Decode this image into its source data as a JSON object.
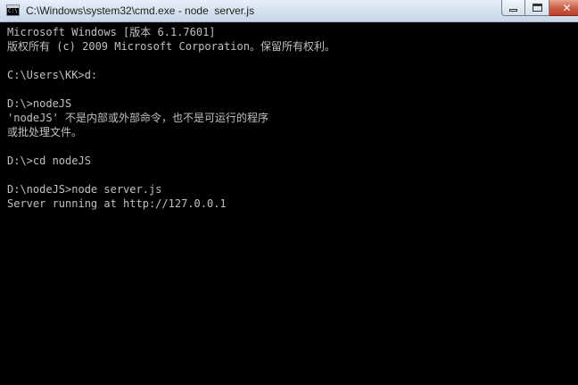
{
  "window": {
    "title": "C:\\Windows\\system32\\cmd.exe - node  server.js",
    "icon": "cmd-icon",
    "minimize_icon": "minimize-icon",
    "maximize_icon": "maximize-icon",
    "close_icon": "close-icon",
    "close_glyph": "✕"
  },
  "console": {
    "lines": [
      "Microsoft Windows [版本 6.1.7601]",
      "版权所有 (c) 2009 Microsoft Corporation。保留所有权利。",
      "",
      "C:\\Users\\KK>d:",
      "",
      "D:\\>nodeJS",
      "'nodeJS' 不是内部或外部命令，也不是可运行的程序",
      "或批处理文件。",
      "",
      "D:\\>cd nodeJS",
      "",
      "D:\\nodeJS>node server.js",
      "Server running at http://127.0.0.1"
    ]
  },
  "colors": {
    "console_bg": "#000000",
    "console_fg": "#c0c0c0",
    "close_button": "#c43d27"
  }
}
